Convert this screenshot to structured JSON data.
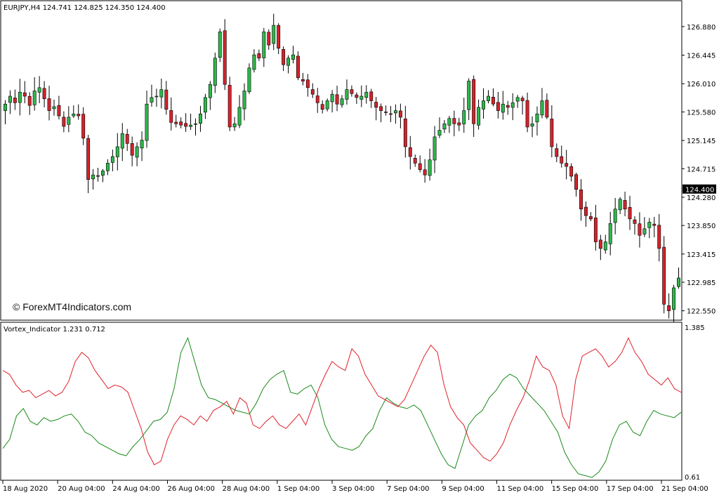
{
  "window": {
    "price_header": "EURJPY,H4  124.741 124.825 124.350 124.400",
    "watermark": "© ForexMT4Indicators.com",
    "current_price_label": "124.400"
  },
  "indicator": {
    "header": "Vortex_Indicator 1.231 0.712",
    "scale_top": "1.385",
    "scale_bottom": "0.61"
  },
  "colors": {
    "bull": "#2db84a",
    "bear": "#d4232b",
    "vi_plus": "#1a8a1a",
    "vi_minus": "#e0202a",
    "frame": "#000000",
    "price_tag_bg": "#000000",
    "price_tag_text": "#ffffff"
  },
  "chart_data": [
    {
      "type": "candlestick",
      "symbol": "EURJPY",
      "timeframe": "H4",
      "ohlc_header": {
        "open": 124.741,
        "high": 124.825,
        "low": 124.35,
        "close": 124.4
      },
      "ylim": [
        122.45,
        127.2
      ],
      "y_ticks": [
        126.88,
        126.445,
        126.01,
        125.58,
        125.145,
        124.715,
        124.28,
        123.85,
        123.415,
        122.985,
        122.55
      ],
      "x_ticks": [
        "18 Aug 2020",
        "20 Aug 04:00",
        "24 Aug 04:00",
        "26 Aug 04:00",
        "28 Aug 04:00",
        "1 Sep 04:00",
        "3 Sep 04:00",
        "7 Sep 04:00",
        "9 Sep 04:00",
        "11 Sep 04:00",
        "15 Sep 04:00",
        "17 Sep 04:00",
        "21 Sep 04:00"
      ],
      "closes": [
        125.7,
        125.82,
        125.72,
        125.88,
        125.82,
        125.68,
        125.9,
        125.95,
        125.78,
        125.6,
        125.66,
        125.52,
        125.36,
        125.5,
        125.55,
        125.52,
        125.18,
        124.55,
        124.62,
        124.6,
        124.68,
        124.8,
        124.9,
        125.05,
        125.25,
        125.1,
        124.92,
        125.05,
        125.15,
        125.7,
        125.8,
        125.82,
        125.92,
        125.62,
        125.42,
        125.4,
        125.38,
        125.36,
        125.38,
        125.4,
        125.55,
        125.8,
        126.0,
        126.4,
        126.8,
        126.0,
        125.35,
        125.4,
        125.65,
        125.9,
        126.25,
        126.45,
        126.4,
        126.8,
        126.6,
        126.9,
        126.55,
        126.3,
        126.4,
        126.45,
        126.1,
        126.05,
        125.95,
        125.85,
        125.72,
        125.62,
        125.75,
        125.85,
        125.7,
        125.78,
        125.92,
        125.86,
        125.8,
        125.82,
        125.88,
        125.75,
        125.65,
        125.6,
        125.58,
        125.55,
        125.6,
        125.5,
        125.05,
        124.9,
        124.8,
        124.7,
        124.62,
        124.85,
        125.2,
        125.3,
        125.4,
        125.48,
        125.4,
        125.38,
        125.6,
        126.05,
        125.4,
        125.65,
        125.75,
        125.82,
        125.7,
        125.6,
        125.7,
        125.65,
        125.72,
        125.8,
        125.75,
        125.35,
        125.4,
        125.55,
        125.75,
        125.5,
        125.05,
        124.9,
        124.8,
        124.75,
        124.6,
        124.4,
        124.1,
        124.0,
        123.95,
        123.6,
        123.5,
        123.6,
        123.88,
        124.1,
        124.25,
        124.1,
        123.95,
        123.88,
        123.7,
        123.8,
        123.9,
        123.85,
        123.5,
        122.65,
        122.55,
        122.9,
        123.05
      ]
    },
    {
      "type": "line",
      "name": "Vortex_Indicator",
      "header_values": [
        1.231,
        0.712
      ],
      "ylim": [
        0.61,
        1.385
      ],
      "series": [
        {
          "name": "VI+",
          "values": [
            0.77,
            0.82,
            0.95,
            0.99,
            0.92,
            0.9,
            0.94,
            0.92,
            0.93,
            0.95,
            0.96,
            0.92,
            0.86,
            0.84,
            0.8,
            0.78,
            0.76,
            0.74,
            0.73,
            0.78,
            0.82,
            0.87,
            0.92,
            0.93,
            0.97,
            1.1,
            1.3,
            1.38,
            1.25,
            1.12,
            1.05,
            1.04,
            1.02,
            1.0,
            0.98,
            0.97,
            0.96,
            1.02,
            1.1,
            1.15,
            1.18,
            1.2,
            1.08,
            1.07,
            1.1,
            1.12,
            1.05,
            0.9,
            0.82,
            0.78,
            0.77,
            0.76,
            0.78,
            0.84,
            0.88,
            0.98,
            1.05,
            1.02,
            1.0,
            0.99,
            1.01,
            0.98,
            0.9,
            0.82,
            0.74,
            0.68,
            0.66,
            0.78,
            0.9,
            0.95,
            0.98,
            1.05,
            1.09,
            1.15,
            1.18,
            1.16,
            1.1,
            1.06,
            1.02,
            0.98,
            0.92,
            0.86,
            0.75,
            0.68,
            0.63,
            0.62,
            0.61,
            0.64,
            0.7,
            0.82,
            0.9,
            0.92,
            0.86,
            0.84,
            0.92,
            0.98,
            0.96,
            0.95,
            0.94,
            0.97
          ]
        },
        {
          "name": "VI-",
          "values": [
            1.2,
            1.18,
            1.12,
            1.08,
            1.09,
            1.05,
            1.07,
            1.09,
            1.06,
            1.08,
            1.14,
            1.25,
            1.3,
            1.27,
            1.2,
            1.15,
            1.1,
            1.12,
            1.11,
            1.08,
            0.98,
            0.88,
            0.75,
            0.68,
            0.7,
            0.82,
            0.9,
            0.95,
            0.93,
            0.9,
            0.95,
            0.92,
            0.98,
            1.0,
            1.03,
            0.96,
            1.05,
            1.02,
            0.9,
            0.88,
            0.92,
            0.95,
            0.9,
            0.88,
            0.92,
            0.96,
            0.9,
            1.0,
            1.1,
            1.18,
            1.25,
            1.22,
            1.2,
            1.32,
            1.28,
            1.18,
            1.12,
            1.06,
            1.04,
            1.02,
            1.0,
            1.04,
            1.12,
            1.2,
            1.28,
            1.34,
            1.3,
            1.12,
            1.0,
            0.94,
            0.9,
            0.8,
            0.76,
            0.72,
            0.7,
            0.74,
            0.8,
            0.9,
            0.98,
            1.05,
            1.15,
            1.28,
            1.22,
            1.2,
            1.12,
            0.95,
            0.88,
            1.15,
            1.28,
            1.3,
            1.32,
            1.28,
            1.22,
            1.25,
            1.3,
            1.38,
            1.3,
            1.25,
            1.18,
            1.15,
            1.12,
            1.16,
            1.1,
            1.08
          ]
        }
      ]
    }
  ]
}
